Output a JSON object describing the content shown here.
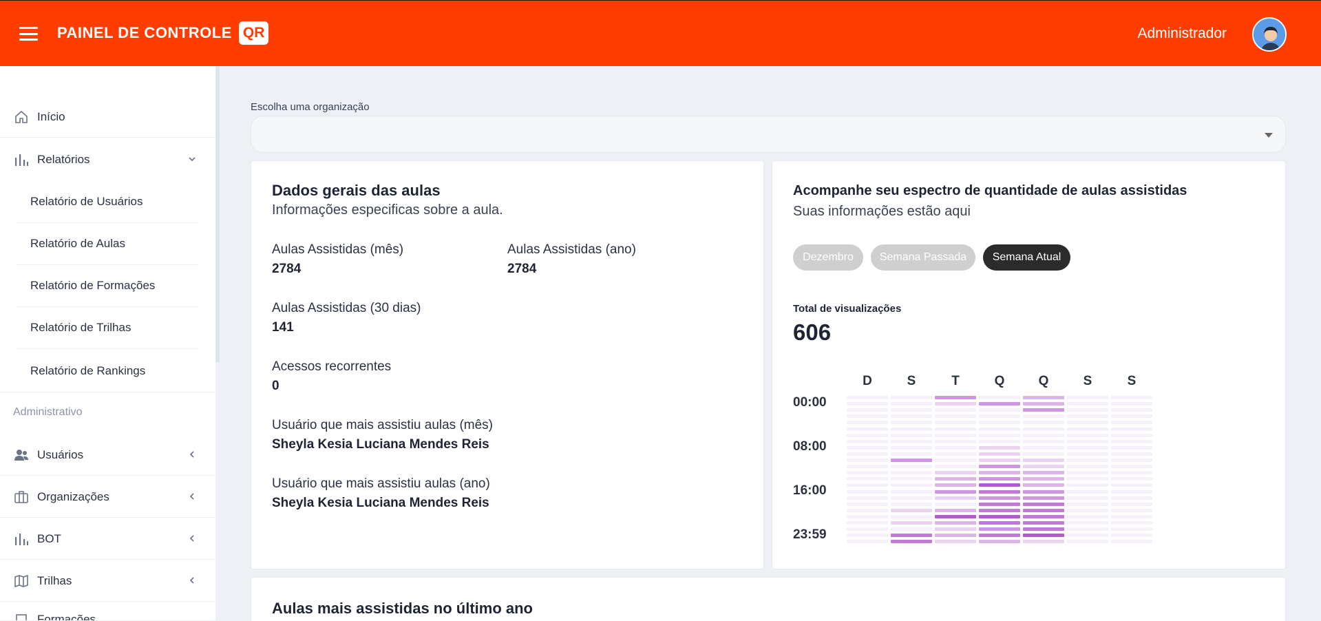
{
  "header": {
    "brand": "PAINEL DE CONTROLE",
    "brand_badge": "QR",
    "user": "Administrador"
  },
  "sidebar": {
    "items": [
      {
        "label": "Início",
        "icon": "home-icon"
      },
      {
        "label": "Relatórios",
        "icon": "bar-chart-icon",
        "chevron": "down"
      }
    ],
    "sub_items": [
      "Relatório de Usuários",
      "Relatório de Aulas",
      "Relatório de Formações",
      "Relatório de Trilhas",
      "Relatório de Rankings"
    ],
    "section": "Administrativo",
    "admin_items": [
      {
        "label": "Usuários",
        "icon": "users-icon"
      },
      {
        "label": "Organizações",
        "icon": "briefcase-icon"
      },
      {
        "label": "BOT",
        "icon": "bar-chart-icon"
      },
      {
        "label": "Trilhas",
        "icon": "map-icon"
      },
      {
        "label": "Formações",
        "icon": "building-icon"
      }
    ]
  },
  "org": {
    "label": "Escolha uma organização",
    "value": ""
  },
  "general": {
    "title": "Dados gerais das aulas",
    "subtitle": "Informações especificas sobre a aula.",
    "stats": {
      "month_label": "Aulas Assistidas (mês)",
      "month_value": "2784",
      "year_label": "Aulas Assistidas (ano)",
      "year_value": "2784",
      "days30_label": "Aulas Assistidas (30 dias)",
      "days30_value": "141",
      "recurrent_label": "Acessos recorrentes",
      "recurrent_value": "0",
      "top_month_label": "Usuário que mais assistiu aulas (mês)",
      "top_month_value": "Sheyla Kesia Luciana Mendes Reis",
      "top_year_label": "Usuário que mais assistiu aulas (ano)",
      "top_year_value": "Sheyla Kesia Luciana Mendes Reis"
    }
  },
  "spectrum": {
    "title": "Acompanhe seu espectro de quantidade de aulas assistidas",
    "subtitle": "Suas informações estão aqui",
    "filters": [
      {
        "label": "Dezembro",
        "active": false
      },
      {
        "label": "Semana Passada",
        "active": false
      },
      {
        "label": "Semana Atual",
        "active": true
      }
    ],
    "total_label": "Total de visualizações",
    "total_value": "606",
    "days": [
      "D",
      "S",
      "T",
      "Q",
      "Q",
      "S",
      "S"
    ],
    "time_labels": [
      "00:00",
      "08:00",
      "16:00",
      "23:59"
    ],
    "colors": {
      "low": "#f6f1f8",
      "high": "#b45ad0"
    },
    "heatmap": [
      [
        0,
        0,
        0,
        0,
        0,
        0,
        0,
        0,
        0,
        0,
        0,
        0,
        0,
        0,
        0,
        0,
        0,
        0,
        0,
        0,
        0,
        0,
        0,
        0
      ],
      [
        0,
        0,
        0,
        0,
        0,
        0,
        0,
        0,
        0,
        0,
        3,
        0,
        0,
        0,
        0,
        0,
        0,
        0,
        1,
        0,
        1,
        0,
        4,
        4
      ],
      [
        3,
        1,
        0,
        0,
        0,
        0,
        0,
        0,
        0,
        0,
        0,
        0,
        1,
        2,
        2,
        3,
        1,
        0,
        2,
        5,
        2,
        1,
        2,
        1
      ],
      [
        0,
        3,
        0,
        0,
        0,
        0,
        0,
        0,
        1,
        1,
        1,
        3,
        2,
        3,
        5,
        4,
        3,
        4,
        4,
        5,
        4,
        3,
        4,
        2
      ],
      [
        2,
        2,
        3,
        0,
        0,
        0,
        0,
        0,
        0,
        0,
        1,
        1,
        2,
        2,
        2,
        3,
        3,
        4,
        4,
        4,
        4,
        4,
        5,
        1
      ],
      [
        0,
        0,
        0,
        0,
        0,
        0,
        0,
        0,
        0,
        0,
        0,
        0,
        0,
        0,
        0,
        0,
        0,
        0,
        0,
        0,
        0,
        0,
        0,
        0
      ],
      [
        0,
        0,
        0,
        0,
        0,
        0,
        0,
        0,
        0,
        0,
        0,
        0,
        0,
        0,
        0,
        0,
        0,
        0,
        0,
        0,
        0,
        0,
        0,
        0
      ]
    ]
  },
  "bottom": {
    "title": "Aulas mais assistidas no último ano"
  }
}
